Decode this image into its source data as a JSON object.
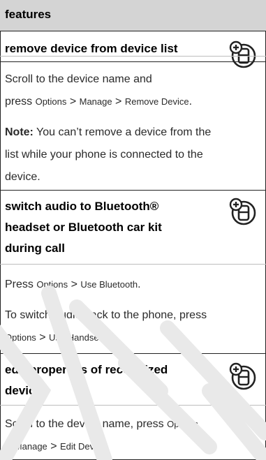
{
  "header": {
    "title": "features"
  },
  "sections": [
    {
      "title_lines": [
        "remove device from device list"
      ],
      "paragraphs": [
        [
          "Scroll to the device name and"
        ],
        [
          "press ",
          {
            "m": "Options"
          },
          " > ",
          {
            "m": "Manage"
          },
          " > ",
          {
            "m": "Remove Device"
          },
          "."
        ]
      ],
      "note_label": "Note:",
      "note_text_lines": [
        "You can’t remove a device from the",
        "list while your phone is connected to the",
        "device."
      ]
    },
    {
      "title_lines": [
        "switch audio to Bluetooth®",
        "headset or Bluetooth car kit",
        "during call"
      ],
      "press_label": "Press ",
      "menu1": "Options",
      "sep": " > ",
      "menu2": "Use Bluetooth",
      "end": ".",
      "line2": "To switch audio back to the phone, press",
      "menu3": "Options",
      "menu4": "Use Handset"
    },
    {
      "title_lines": [
        "edit properties of recognized",
        "device"
      ],
      "line1_text": "Scroll to the device name, press ",
      "menu1": "Options",
      "menu2": "Manage",
      "menu3": "Edit Device"
    }
  ],
  "icon_names": [
    "phone-feature-icon",
    "phone-feature-icon",
    "phone-feature-icon"
  ]
}
